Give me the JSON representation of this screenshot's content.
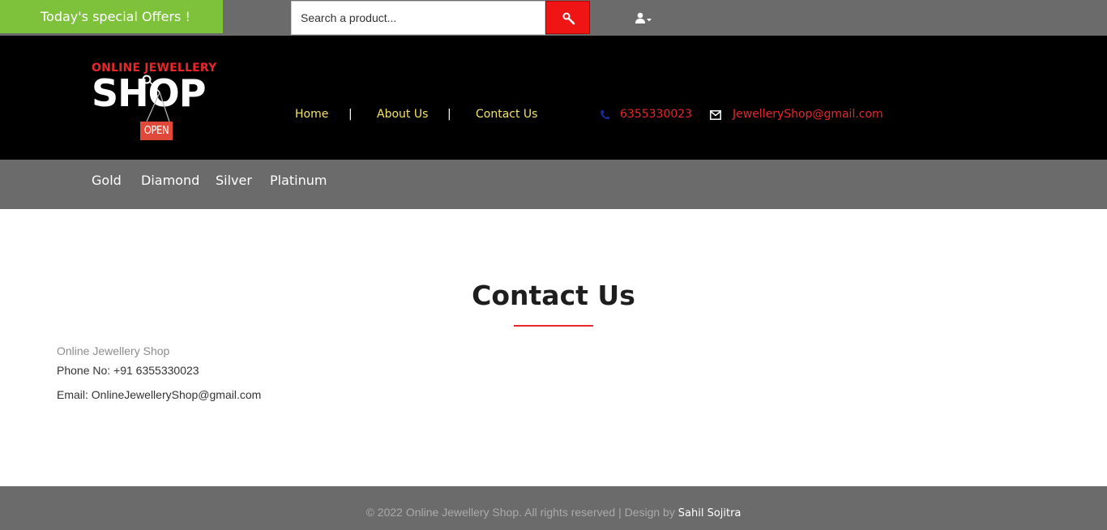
{
  "topbar": {
    "offers_label": "Today's special Offers !",
    "search_placeholder": "Search a product...",
    "search_icon": "search-icon",
    "user_icon": "user-dropdown-icon"
  },
  "header": {
    "logo_top": "ONLINE JEWELLERY",
    "logo_main": "SHOP",
    "logo_sign": "OPEN",
    "nav": [
      {
        "label": "Home"
      },
      {
        "label": "About Us"
      },
      {
        "label": "Contact Us"
      }
    ],
    "separator": "|",
    "phone": "6355330023",
    "email": "JewelleryShop@gmail.com"
  },
  "categories": [
    "Gold",
    "Diamond",
    "Silver",
    "Platinum"
  ],
  "main": {
    "title": "Contact Us",
    "shop_name": "Online Jewellery Shop",
    "phone_line": "Phone No: +91 6355330023",
    "email_line": "Email: OnlineJewelleryShop@gmail.com"
  },
  "footer": {
    "text": "© 2022 Online Jewellery Shop. All rights reserved | Design by",
    "designer": "Sahil Sojitra"
  },
  "colors": {
    "accent_red": "#e8262b",
    "offer_green": "#7dc23a",
    "nav_yellow": "#f3e36a",
    "bar_gray": "#6b6b6b"
  }
}
